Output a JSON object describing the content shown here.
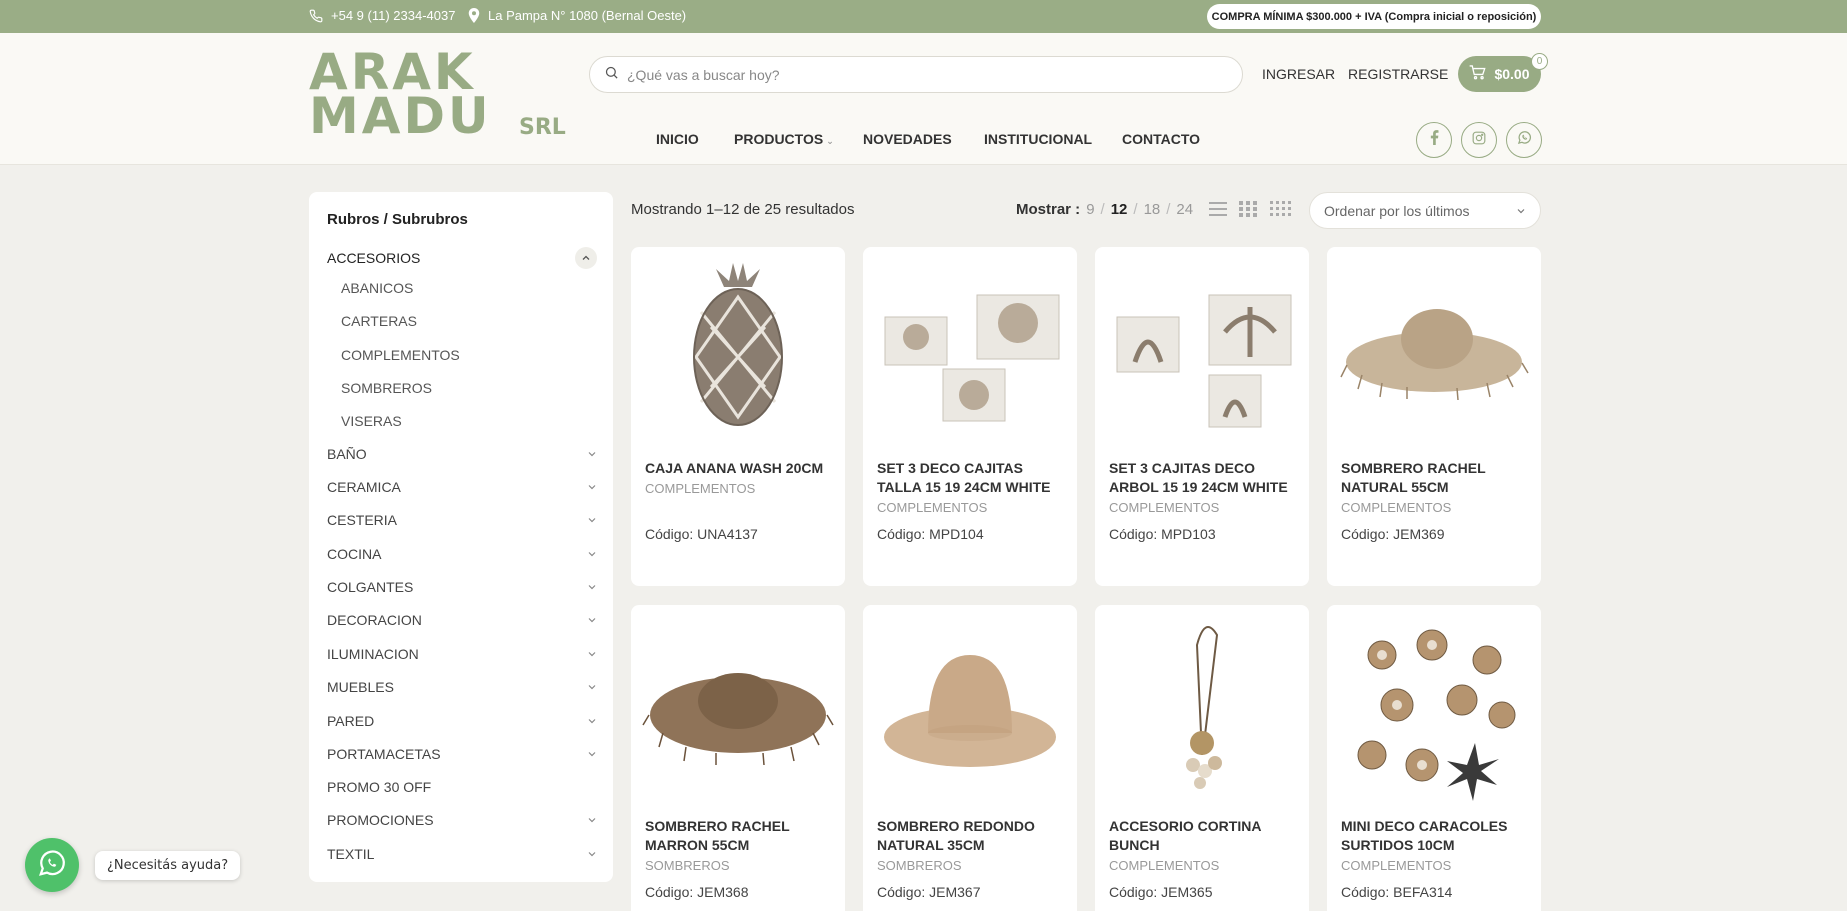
{
  "topbar": {
    "phone": "+54 9 (11) 2334-4037",
    "address": "La Pampa N° 1080 (Bernal Oeste)",
    "min_purchase": "COMPRA MÍNIMA $300.000 + IVA (Compra inicial o reposición)"
  },
  "logo": {
    "line1": "ARAK",
    "line2": "MADU",
    "suffix": "SRL"
  },
  "search": {
    "placeholder": "¿Qué vas a buscar hoy?"
  },
  "account": {
    "login": "INGRESAR",
    "register": "REGISTRARSE"
  },
  "cart": {
    "total": "$0.00",
    "count": "0"
  },
  "nav": {
    "items": [
      {
        "label": "INICIO"
      },
      {
        "label": "PRODUCTOS"
      },
      {
        "label": "NOVEDADES"
      },
      {
        "label": "INSTITUCIONAL"
      },
      {
        "label": "CONTACTO"
      }
    ]
  },
  "social": [
    "facebook-icon",
    "instagram-icon",
    "whatsapp-icon"
  ],
  "sidebar": {
    "title": "Rubros / Subrubros",
    "active": {
      "label": "ACCESORIOS"
    },
    "subcategories": [
      "ABANICOS",
      "CARTERAS",
      "COMPLEMENTOS",
      "SOMBREROS",
      "VISERAS"
    ],
    "categories": [
      {
        "label": "BAÑO"
      },
      {
        "label": "CERAMICA"
      },
      {
        "label": "CESTERIA"
      },
      {
        "label": "COCINA"
      },
      {
        "label": "COLGANTES"
      },
      {
        "label": "DECORACION"
      },
      {
        "label": "ILUMINACION"
      },
      {
        "label": "MUEBLES"
      },
      {
        "label": "PARED"
      },
      {
        "label": "PORTAMACETAS"
      },
      {
        "label": "PROMO 30 OFF"
      },
      {
        "label": "PROMOCIONES"
      },
      {
        "label": "TEXTIL"
      }
    ]
  },
  "toolbar": {
    "results": "Mostrando 1–12 de 25 resultados",
    "show_label": "Mostrar :",
    "show_options": [
      "9",
      "12",
      "18",
      "24"
    ],
    "show_selected": "12",
    "sort": "Ordenar por los últimos"
  },
  "products": [
    {
      "title": "CAJA ANANA WASH 20CM",
      "category": "COMPLEMENTOS",
      "code": "Código: UNA4137"
    },
    {
      "title": "SET 3 DECO CAJITAS TALLA 15 19 24CM WHITE",
      "category": "COMPLEMENTOS",
      "code": "Código: MPD104"
    },
    {
      "title": "SET 3 CAJITAS DECO ARBOL 15 19 24CM WHITE",
      "category": "COMPLEMENTOS",
      "code": "Código: MPD103"
    },
    {
      "title": "SOMBRERO RACHEL NATURAL 55CM",
      "category": "COMPLEMENTOS",
      "code": "Código: JEM369"
    },
    {
      "title": "SOMBRERO RACHEL MARRON 55CM",
      "category": "SOMBREROS",
      "code": "Código: JEM368"
    },
    {
      "title": "SOMBRERO REDONDO NATURAL 35CM",
      "category": "SOMBREROS",
      "code": "Código: JEM367"
    },
    {
      "title": "ACCESORIO CORTINA BUNCH",
      "category": "COMPLEMENTOS",
      "code": "Código: JEM365"
    },
    {
      "title": "MINI DECO CARACOLES SURTIDOS 10CM",
      "category": "COMPLEMENTOS",
      "code": "Código: BEFA314"
    }
  ],
  "whatsapp": {
    "help": "¿Necesitás ayuda?"
  },
  "colors": {
    "brand": "#98ab84",
    "topbar": "#9aad86",
    "whatsapp": "#4fc16a"
  }
}
